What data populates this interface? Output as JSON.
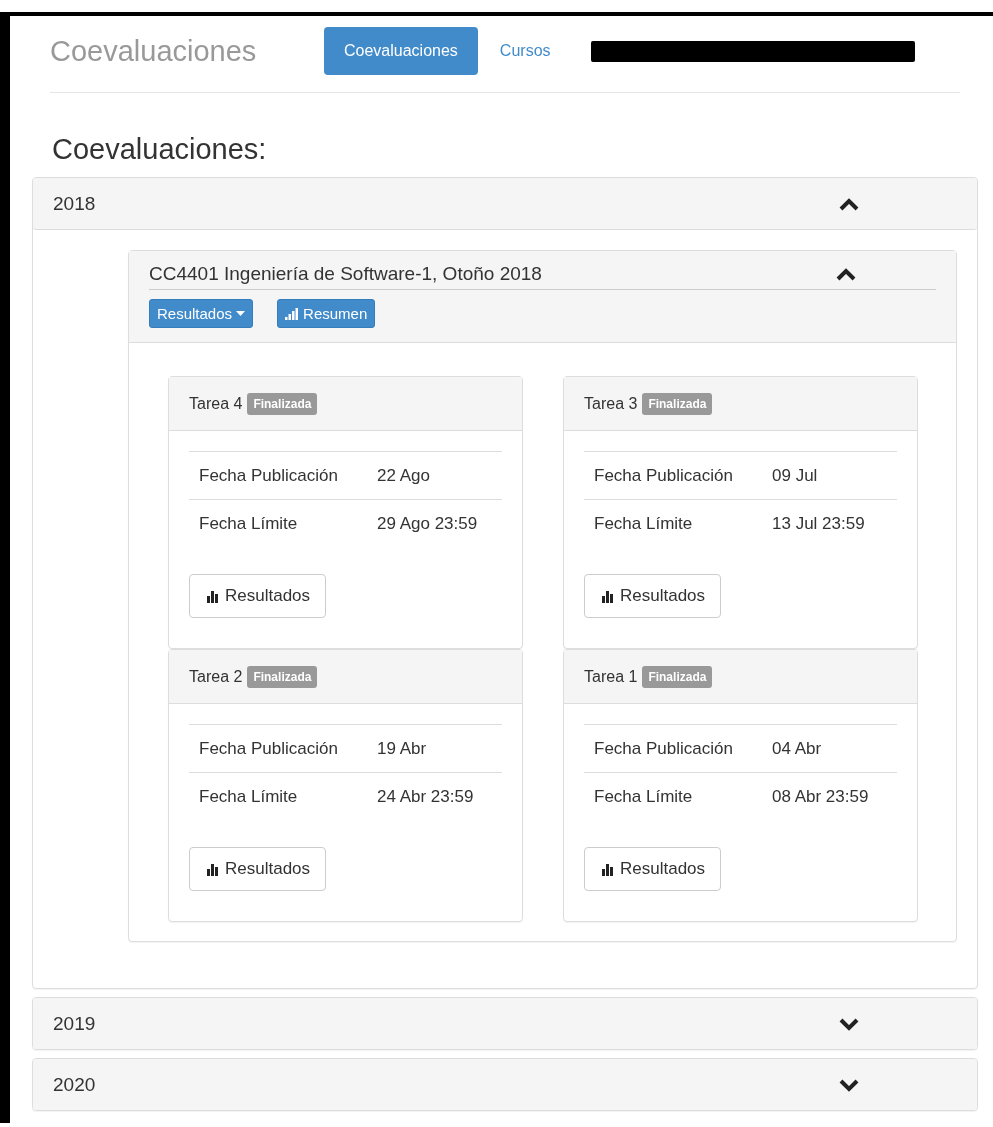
{
  "nav": {
    "brand": "Coevaluaciones",
    "links": [
      {
        "label": "Coevaluaciones",
        "selected": true
      },
      {
        "label": "Cursos",
        "selected": false
      }
    ]
  },
  "heading": "Coevaluaciones:",
  "years": [
    {
      "label": "2018",
      "expanded": true,
      "courses": [
        {
          "title": "CC4401 Ingeniería de Software-1, Otoño 2018",
          "expanded": true,
          "buttons": [
            {
              "label": "Resultados",
              "kind": "dropdown"
            },
            {
              "label": "Resumen",
              "kind": "summary"
            }
          ],
          "tasks": [
            {
              "name": "Tarea 4",
              "status": "Finalizada",
              "rows": [
                {
                  "label": "Fecha Publicación",
                  "value": "22 Ago"
                },
                {
                  "label": "Fecha Límite",
                  "value": "29 Ago 23:59"
                }
              ],
              "button": "Resultados"
            },
            {
              "name": "Tarea 3",
              "status": "Finalizada",
              "rows": [
                {
                  "label": "Fecha Publicación",
                  "value": "09 Jul"
                },
                {
                  "label": "Fecha Límite",
                  "value": "13 Jul 23:59"
                }
              ],
              "button": "Resultados"
            },
            {
              "name": "Tarea 2",
              "status": "Finalizada",
              "rows": [
                {
                  "label": "Fecha Publicación",
                  "value": "19 Abr"
                },
                {
                  "label": "Fecha Límite",
                  "value": "24 Abr 23:59"
                }
              ],
              "button": "Resultados"
            },
            {
              "name": "Tarea 1",
              "status": "Finalizada",
              "rows": [
                {
                  "label": "Fecha Publicación",
                  "value": "04 Abr"
                },
                {
                  "label": "Fecha Límite",
                  "value": "08 Abr 23:59"
                }
              ],
              "button": "Resultados"
            }
          ]
        }
      ]
    },
    {
      "label": "2019",
      "expanded": false
    },
    {
      "label": "2020",
      "expanded": false
    }
  ]
}
